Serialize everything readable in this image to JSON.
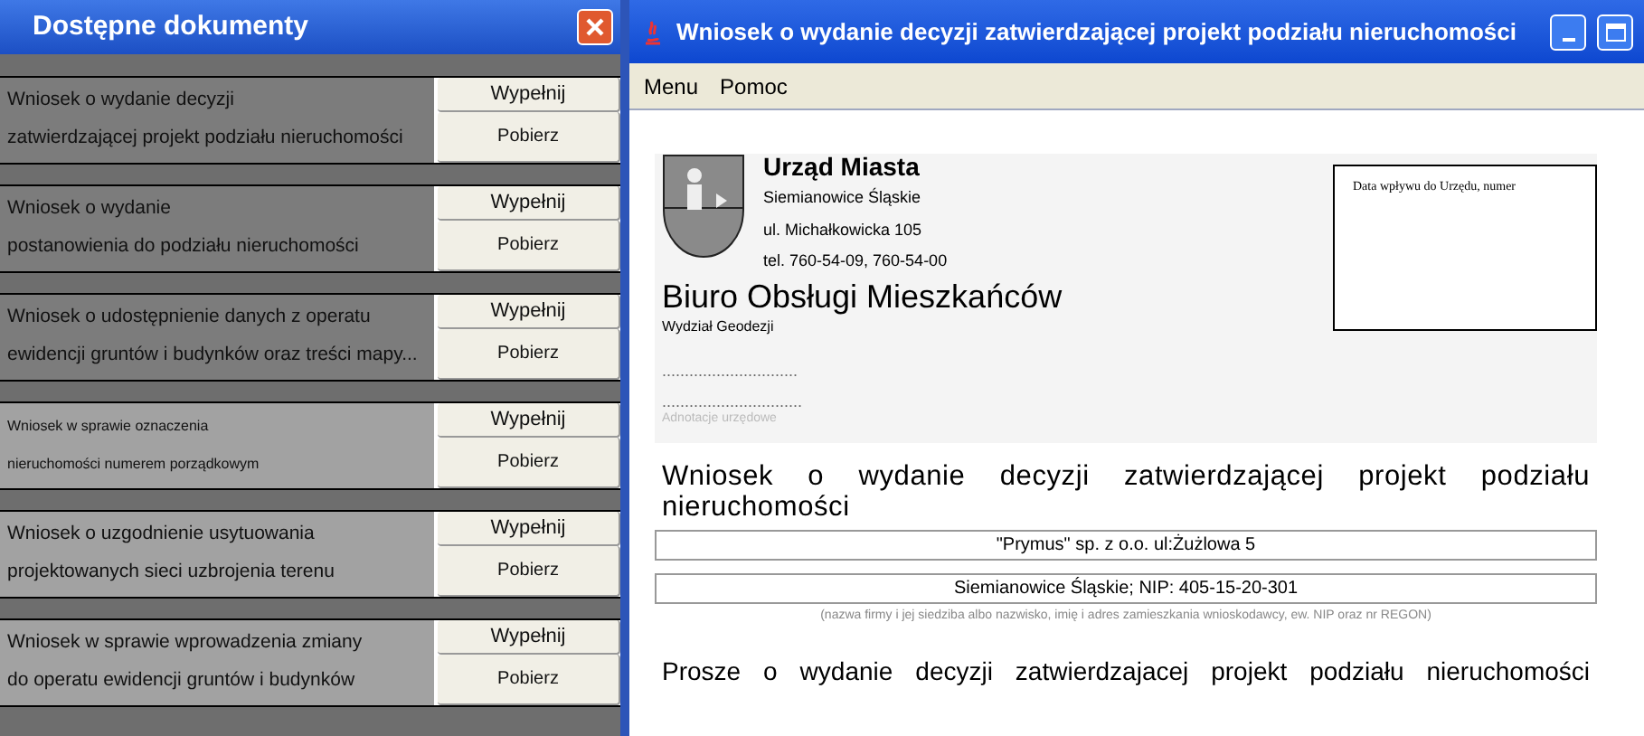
{
  "documents_panel": {
    "title": "Dostępne dokumenty",
    "items": [
      {
        "lines": [
          "Wniosek o wydanie decyzji",
          "zatwierdzającej projekt podziału nieruchomości"
        ],
        "small": false,
        "fill": "Wypełnij",
        "download": "Pobierz"
      },
      {
        "lines": [
          "Wniosek o wydanie",
          "postanowienia do podziału nieruchomości"
        ],
        "small": false,
        "fill": "Wypełnij",
        "download": "Pobierz"
      },
      {
        "lines": [
          "Wniosek o udostępnienie danych z operatu",
          "ewidencji gruntów i budynków oraz treści mapy..."
        ],
        "small": false,
        "fill": "Wypełnij",
        "download": "Pobierz"
      },
      {
        "lines": [
          "Wniosek w sprawie oznaczenia",
          "nieruchomości numerem porządkowym"
        ],
        "small": true,
        "fill": "Wypełnij",
        "download": "Pobierz"
      },
      {
        "lines": [
          "Wniosek o uzgodnienie usytuowania",
          "projektowanych sieci uzbrojenia terenu"
        ],
        "small": false,
        "fill": "Wypełnij",
        "download": "Pobierz"
      },
      {
        "lines": [
          "Wniosek w sprawie wprowadzenia zmiany",
          "do operatu ewidencji gruntów i budynków"
        ],
        "small": false,
        "fill": "Wypełnij",
        "download": "Pobierz"
      }
    ]
  },
  "form_window": {
    "title": "Wniosek o wydanie decyzji  zatwierdzającej projekt podziału nieruchomości",
    "menu": [
      "Menu",
      "Pomoc"
    ],
    "office": {
      "name": "Urząd Miasta",
      "city": "Siemianowice Śląskie",
      "street": "ul. Michałkowicka 105",
      "phone": "tel. 760-54-09, 760-54-00"
    },
    "bureau": "Biuro Obsługi Mieszkańców",
    "department": "Wydział Geodezji",
    "dots": [
      "..............................",
      "..............................."
    ],
    "annotation": "Adnotacje urzędowe",
    "stamp_label": "Data wpływu do Urzędu, numer",
    "heading": "Wniosek o wydanie decyzji zatwierdzającej projekt podziału nieruchomości",
    "fields": [
      "\"Prymus\" sp. z o.o.  ul:Żużlowa 5",
      "Siemianowice Śląskie; NIP: 405-15-20-301"
    ],
    "fields_caption": "(nazwa firmy i jej siedziba albo nazwisko, imię i adres zamieszkania wnioskodawcy, ew. NIP oraz nr REGON)",
    "body": "Prosze o wydanie decyzji zatwierdzajacej projekt podziału nieruchomości"
  }
}
